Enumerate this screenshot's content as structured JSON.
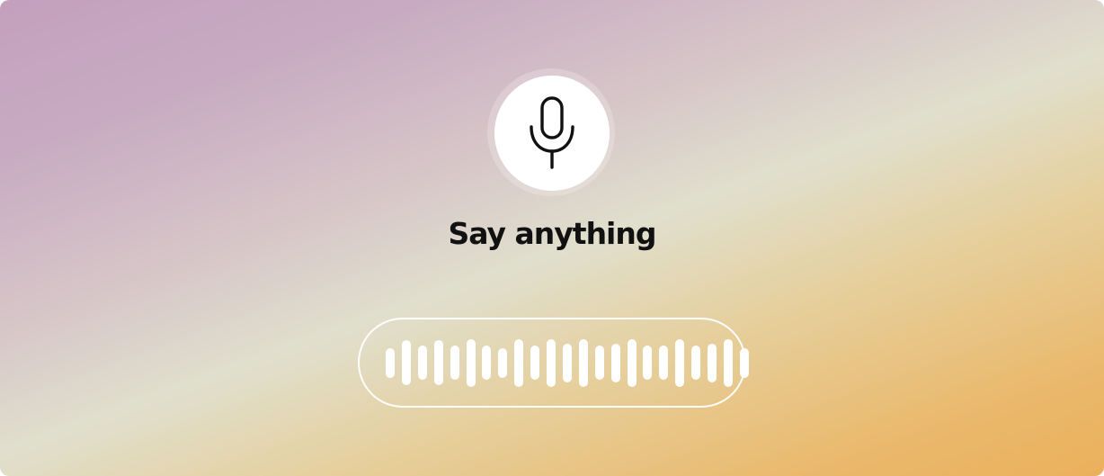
{
  "prompt": {
    "text": "Say anything"
  },
  "mic": {
    "icon": "microphone-icon"
  },
  "waveform": {
    "icon": "audio-waveform",
    "bar_levels": [
      0.44,
      0.68,
      0.52,
      0.68,
      0.52,
      0.72,
      0.52,
      0.44,
      0.72,
      0.52,
      0.72,
      0.58,
      0.72,
      0.52,
      0.58,
      0.72,
      0.52,
      0.52,
      0.72,
      0.52,
      0.58,
      0.72,
      0.44
    ]
  },
  "colors": {
    "gradient_top_left": "#c3a0bd",
    "gradient_middle": "#e0dfcd",
    "gradient_bottom_right": "#ebb05c",
    "text": "#111111",
    "mic_button": "#ffffff",
    "wave": "#ffffff"
  }
}
